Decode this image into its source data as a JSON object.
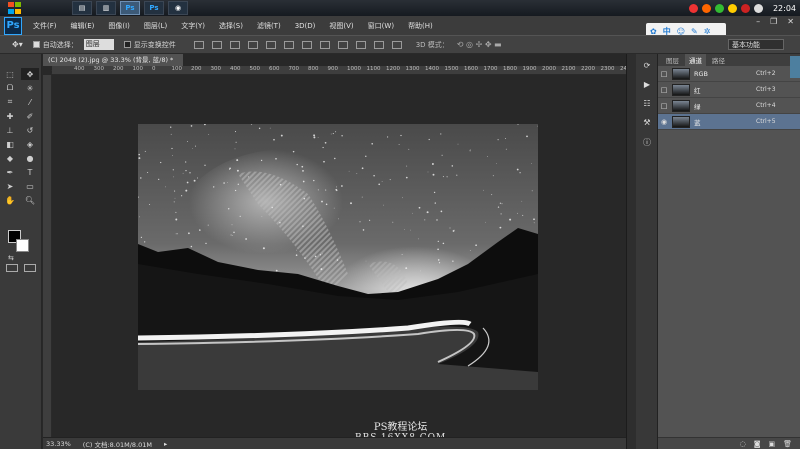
{
  "taskbar": {
    "apps": [
      "file-manager-app",
      "notes-app",
      "photoshop-app",
      "photoshop-app",
      "chrome-app"
    ],
    "clock": "22:04"
  },
  "menubar": {
    "logo": "Ps",
    "items": [
      "文件(F)",
      "编辑(E)",
      "图像(I)",
      "图层(L)",
      "文字(Y)",
      "选择(S)",
      "滤镜(T)",
      "3D(D)",
      "视图(V)",
      "窗口(W)",
      "帮助(H)"
    ],
    "ime_label": "中"
  },
  "options": {
    "auto_select_label": "自动选择：",
    "auto_select_value": "图层",
    "show_transform_label": "显示变换控件",
    "mode_3d_label": "3D 模式：",
    "workspace": "基本功能"
  },
  "document": {
    "tab_title": "(C) 2048 (2).jpg @ 33.3% (背景, 蓝/8) *",
    "ruler_ticks": [
      "400",
      "300",
      "200",
      "100",
      "0",
      "100",
      "200",
      "300",
      "400",
      "500",
      "600",
      "700",
      "800",
      "900",
      "1000",
      "1100",
      "1200",
      "1300",
      "1400",
      "1500",
      "1600",
      "1700",
      "1800",
      "1900",
      "2000",
      "2100",
      "2200",
      "2300",
      "2400"
    ],
    "zoom": "33.33%",
    "doc_info": "(C) 文档:8.01M/8.01M"
  },
  "watermark": {
    "line1": "PS教程论坛",
    "line2": "BBS.16XX8.COM"
  },
  "channels_panel": {
    "tabs": [
      "图层",
      "通道",
      "路径"
    ],
    "active_tab": 1,
    "rows": [
      {
        "name": "RGB",
        "shortcut": "Ctrl+2",
        "selected": false
      },
      {
        "name": "红",
        "shortcut": "Ctrl+3",
        "selected": false
      },
      {
        "name": "绿",
        "shortcut": "Ctrl+4",
        "selected": false
      },
      {
        "name": "蓝",
        "shortcut": "Ctrl+5",
        "selected": true
      }
    ]
  },
  "colors": {
    "selected_row": "#5c7391",
    "ps_blue": "#31a8ff"
  }
}
